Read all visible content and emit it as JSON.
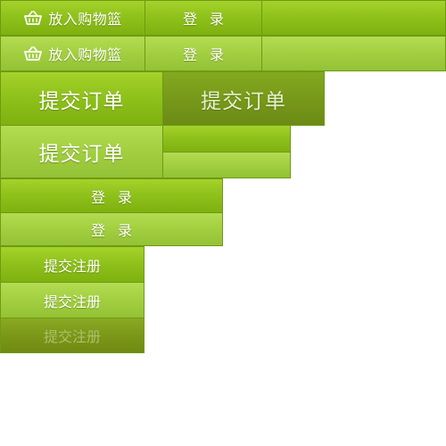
{
  "buttons": {
    "add_to_cart_label": "放入购物篮",
    "login_char_1": "登",
    "login_char_2": "录",
    "submit_order_label": "提交订单",
    "submit_register_label": "提交注册"
  },
  "icons": {
    "cart": "basket-icon"
  },
  "colors": {
    "green_light": "#a4d32a",
    "green_mid": "#90c21c",
    "green_dark": "#7eb10f",
    "green_pressed": "#77991a",
    "border": "#6f9a12"
  }
}
